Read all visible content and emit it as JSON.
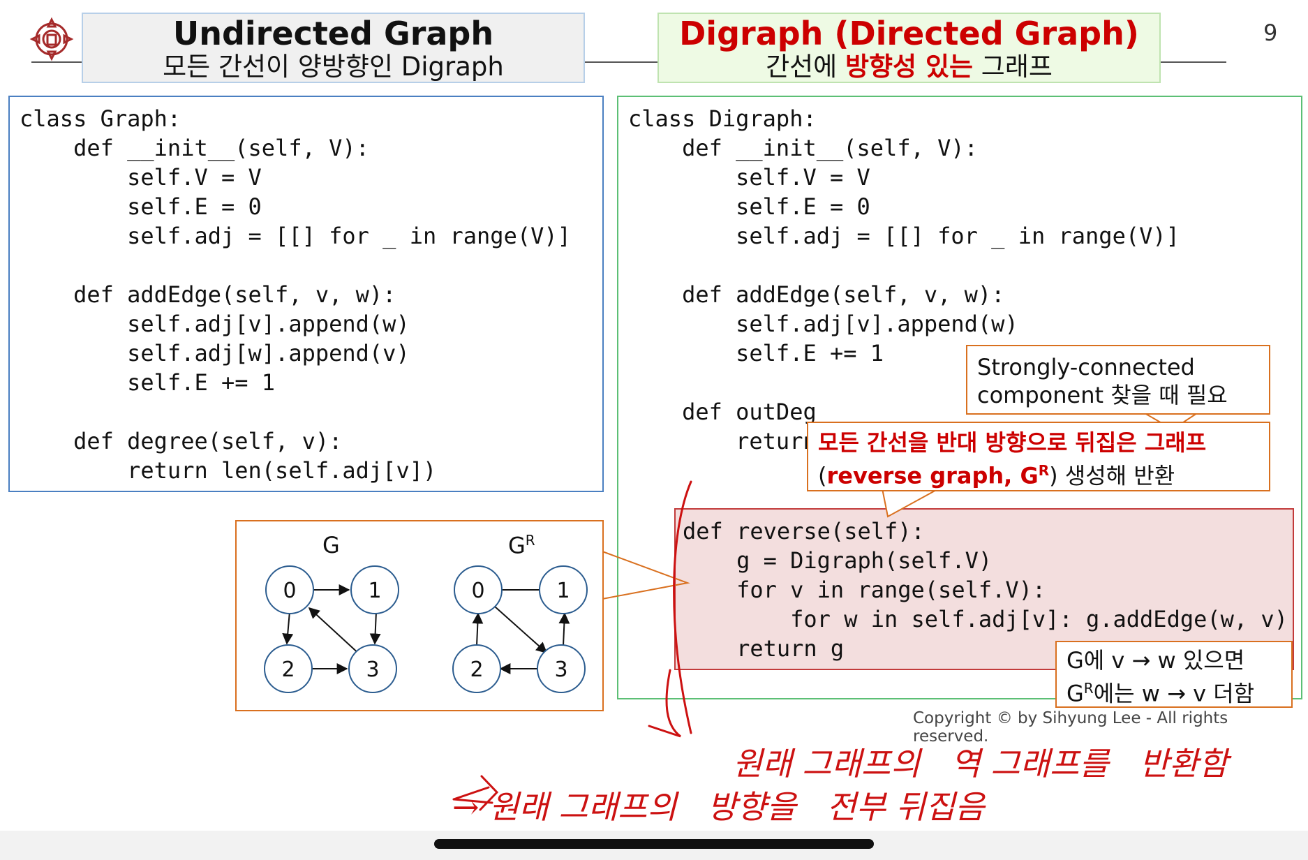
{
  "page_number": "9",
  "left_title": {
    "main": "Undirected Graph",
    "sub": "모든 간선이 양방향인 Digraph"
  },
  "right_title": {
    "part1": "Digraph (",
    "part2": "Directed",
    "part3": " Graph)",
    "sub_pre": "간선에 ",
    "sub_red": "방향성 있는",
    "sub_post": " 그래프"
  },
  "graph_code": [
    "class Graph:",
    "    def __init__(self, V):",
    "        self.V = V",
    "        self.E = 0",
    "        self.adj = [[] for _ in range(V)]",
    "",
    "    def addEdge(self, v, w):",
    "        self.adj[v].append(w)",
    "        self.adj[w].append(v)",
    "        self.E += 1",
    "",
    "    def degree(self, v):",
    "        return len(self.adj[v])"
  ],
  "digraph_code": [
    "class Digraph:",
    "    def __init__(self, V):",
    "        self.V = V",
    "        self.E = 0",
    "        self.adj = [[] for _ in range(V)]",
    "",
    "    def addEdge(self, v, w):",
    "        self.adj[v].append(w)",
    "        self.E += 1",
    "",
    "    def outDeg",
    "        return"
  ],
  "reverse_code": [
    "def reverse(self):",
    "    g = Digraph(self.V)",
    "    for v in range(self.V):",
    "        for w in self.adj[v]: g.addEdge(w, v)",
    "    return g"
  ],
  "callout_scc": {
    "line1": "Strongly-connected",
    "line2": "component 찾을 때 필요"
  },
  "callout_reverse": {
    "line1": "모든 간선을 반대 방향으로 뒤집은 그래프",
    "line2_pre": "(",
    "line2_red": "reverse graph, G",
    "line2_sup": "R",
    "line2_post": ") 생성해 반환"
  },
  "callout_edge": {
    "line1": "G에 v → w 있으면",
    "line2_g": "G",
    "line2_sup": "R",
    "line2_post": "에는 w → v 더함"
  },
  "graph_g": {
    "label": "G",
    "nodes": [
      "0",
      "1",
      "2",
      "3"
    ]
  },
  "graph_gr": {
    "label": "G",
    "label_sup": "R",
    "nodes": [
      "0",
      "1",
      "2",
      "3"
    ]
  },
  "copyright": "Copyright © by Sihyung Lee - All rights reserved.",
  "handwriting": {
    "line1": "원래 그래프의   역 그래프를   반환함",
    "line2": "→ 원래 그래프의   방향을   전부 뒤집음"
  },
  "colors": {
    "accent_red": "#cc0000",
    "orange_border": "#d9701f",
    "blue_border": "#4a7fc1",
    "green_border": "#5cbf75",
    "highlight_fill": "#f3dede"
  }
}
